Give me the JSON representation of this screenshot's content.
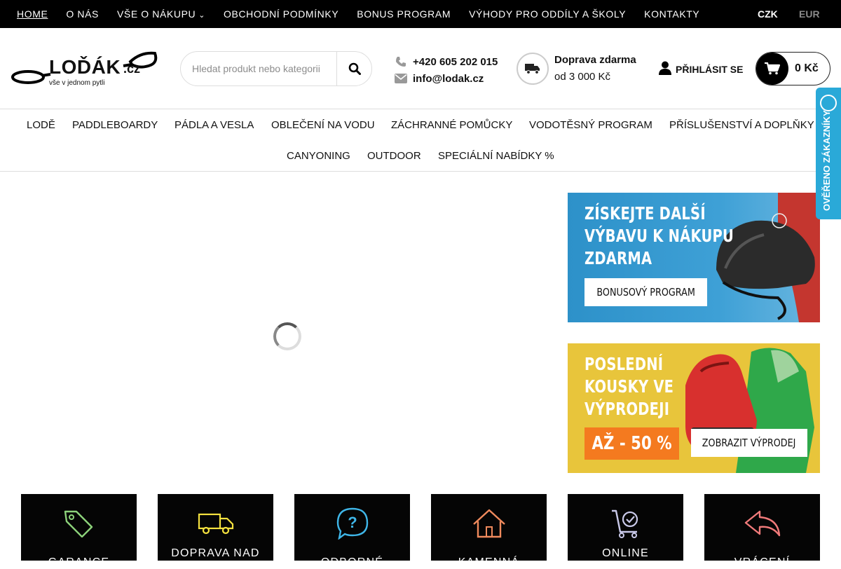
{
  "topnav": {
    "items": [
      {
        "label": "HOME",
        "active": true
      },
      {
        "label": "O NÁS"
      },
      {
        "label": "VŠE O NÁKUPU",
        "has_dropdown": true
      },
      {
        "label": "OBCHODNÍ PODMÍNKY"
      },
      {
        "label": "BONUS PROGRAM"
      },
      {
        "label": "VÝHODY PRO ODDÍLY A ŠKOLY"
      },
      {
        "label": "KONTAKTY"
      }
    ],
    "currency": {
      "czk": "CZK",
      "eur": "EUR",
      "selected": "CZK"
    }
  },
  "header": {
    "logo_text": "LOĎÁK",
    "logo_suffix": ".cz",
    "logo_tagline": "vše v jednom pytli",
    "search_placeholder": "Hledat produkt nebo kategorii",
    "phone": "+420 605 202 015",
    "email": "info@lodak.cz",
    "shipping_line1": "Doprava zdarma",
    "shipping_line2": "od 3 000 Kč",
    "login_label": "PŘIHLÁSIT SE",
    "cart_total": "0 Kč"
  },
  "catnav": {
    "row1": [
      "LODĚ",
      "PADDLEBOARDY",
      "PÁDLA A VESLA",
      "OBLEČENÍ NA VODU",
      "ZÁCHRANNÉ POMŮCKY",
      "VODOTĚSNÝ PROGRAM",
      "PŘÍSLUŠENSTVÍ A DOPLŇKY"
    ],
    "row2": [
      "CANYONING",
      "OUTDOOR",
      "SPECIÁLNÍ NABÍDKY %"
    ]
  },
  "banners": {
    "bonus": {
      "title_lines": [
        "ZÍSKEJTE DALŠÍ",
        "VÝBAVU K NÁKUPU",
        "ZDARMA"
      ],
      "button": "BONUSOVÝ PROGRAM"
    },
    "sale": {
      "title_lines": [
        "POSLEDNÍ",
        "KOUSKY VE",
        "VÝPRODEJI"
      ],
      "discount": "AŽ - 50 %",
      "button": "ZOBRAZIT VÝPRODEJ"
    }
  },
  "features": [
    {
      "label": "GARANCE",
      "icon": "tag-icon",
      "color": "#8cd27a"
    },
    {
      "label": "DOPRAVA NAD",
      "icon": "truck-icon",
      "color": "#f5e23f"
    },
    {
      "label": "ODBORNÉ",
      "icon": "question-bubble-icon",
      "color": "#3fb6e8"
    },
    {
      "label": "KAMENNÁ",
      "icon": "house-icon",
      "color": "#f08a5d"
    },
    {
      "label": "ONLINE",
      "icon": "cart-check-icon",
      "color": "#c9c9e9"
    },
    {
      "label": "VRÁCENÍ",
      "icon": "reply-arrow-icon",
      "color": "#f07a7a"
    }
  ],
  "verified_widget": {
    "label": "OVĚŘENO ZÁKAZNÍKY",
    "color": "#2aa9d8"
  }
}
